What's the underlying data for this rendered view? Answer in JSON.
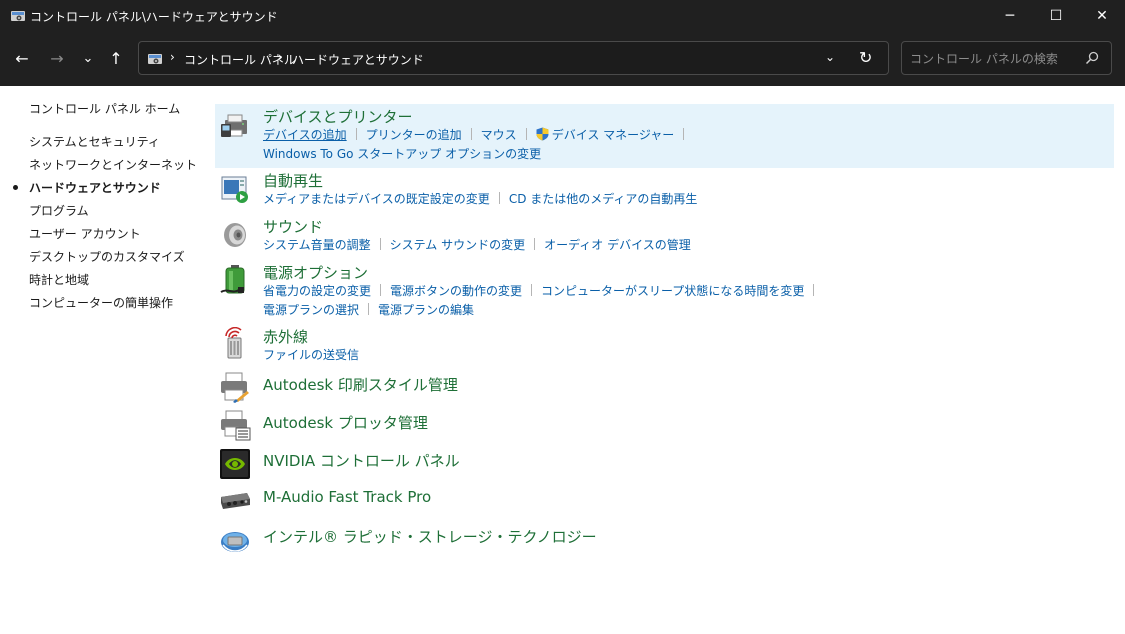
{
  "window": {
    "title": "コントロール パネル\\ハードウェアとサウンド",
    "minimize_glyph": "─",
    "maximize_glyph": "☐",
    "close_glyph": "✕"
  },
  "nav": {
    "back_glyph": "←",
    "forward_glyph": "→",
    "recent_glyph": "⌄",
    "up_glyph": "↑",
    "breadcrumb": [
      "コントロール パネル",
      "ハードウェアとサウンド"
    ],
    "separator": "›",
    "dropdown_glyph": "⌄",
    "refresh_glyph": "↻"
  },
  "search": {
    "placeholder": "コントロール パネルの検索",
    "value": ""
  },
  "sidebar": {
    "home": "コントロール パネル ホーム",
    "items": [
      {
        "label": "システムとセキュリティ"
      },
      {
        "label": "ネットワークとインターネット"
      },
      {
        "label": "ハードウェアとサウンド",
        "active": true
      },
      {
        "label": "プログラム"
      },
      {
        "label": "ユーザー アカウント"
      },
      {
        "label": "デスクトップのカスタマイズ"
      },
      {
        "label": "時計と地域"
      },
      {
        "label": "コンピューターの簡単操作"
      }
    ]
  },
  "categories": [
    {
      "icon": "devices-printers-icon",
      "title": "デバイスとプリンター",
      "highlighted": true,
      "lines": [
        [
          "デバイスの追加",
          "プリンターの追加",
          "マウス",
          "デバイス マネージャー"
        ],
        [
          "Windows To Go スタートアップ オプションの変更"
        ]
      ]
    },
    {
      "icon": "autoplay-icon",
      "title": "自動再生",
      "lines": [
        [
          "メディアまたはデバイスの既定設定の変更",
          "CD または他のメディアの自動再生"
        ]
      ]
    },
    {
      "icon": "speaker-icon",
      "title": "サウンド",
      "lines": [
        [
          "システム音量の調整",
          "システム サウンドの変更",
          "オーディオ デバイスの管理"
        ]
      ]
    },
    {
      "icon": "battery-icon",
      "title": "電源オプション",
      "lines": [
        [
          "省電力の設定の変更",
          "電源ボタンの動作の変更",
          "コンピューターがスリープ状態になる時間を変更"
        ],
        [
          "電源プランの選択",
          "電源プランの編集"
        ]
      ]
    },
    {
      "icon": "infrared-icon",
      "title": "赤外線",
      "lines": [
        [
          "ファイルの送受信"
        ]
      ]
    },
    {
      "icon": "printer-brush-icon",
      "title": "Autodesk 印刷スタイル管理",
      "lines": []
    },
    {
      "icon": "plotter-icon",
      "title": "Autodesk プロッタ管理",
      "lines": []
    },
    {
      "icon": "nvidia-icon",
      "title": "NVIDIA コントロール パネル",
      "lines": []
    },
    {
      "icon": "audio-interface-icon",
      "title": "M-Audio Fast Track Pro",
      "lines": []
    },
    {
      "icon": "intel-storage-icon",
      "title": "インテル® ラピッド・ストレージ・テクノロジー",
      "lines": []
    }
  ]
}
